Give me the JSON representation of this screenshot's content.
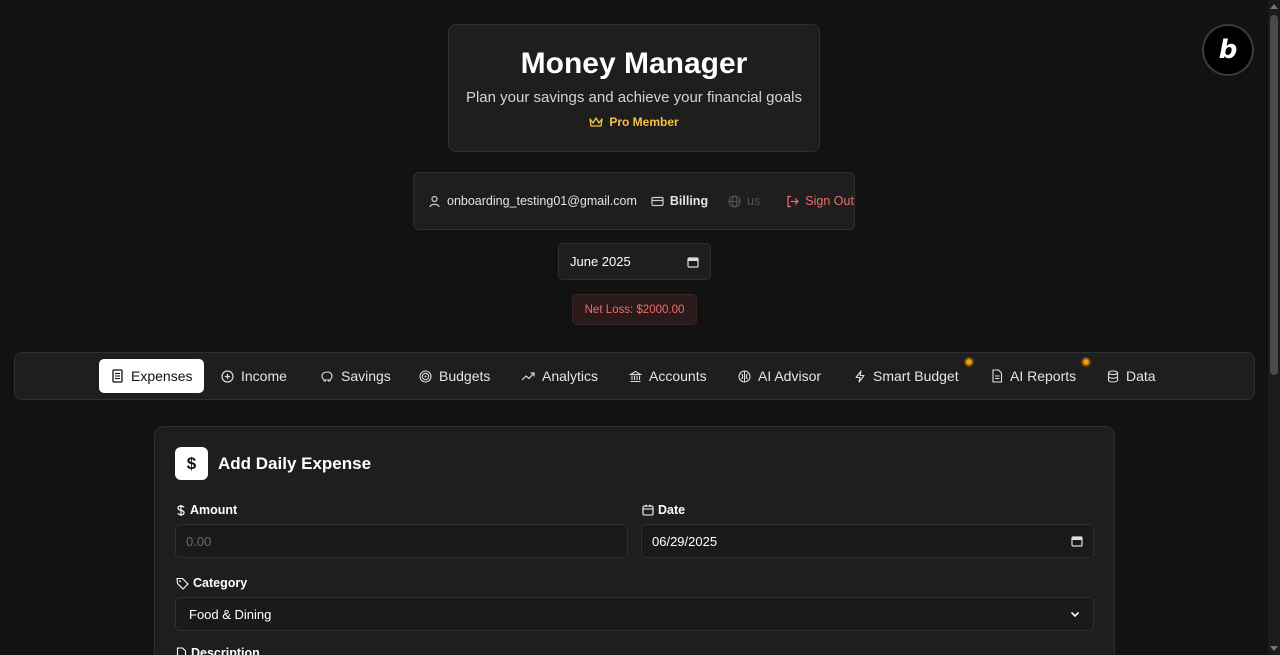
{
  "header": {
    "title": "Money Manager",
    "subtitle": "Plan your savings and achieve your financial goals",
    "badge": "Pro Member"
  },
  "user_bar": {
    "email": "onboarding_testing01@gmail.com",
    "billing": "Billing",
    "language": "us",
    "sign_out": "Sign Out"
  },
  "month_picker": {
    "value": "June 2025"
  },
  "net_loss": "Net Loss: $2000.00",
  "tabs": [
    {
      "label": "Expenses",
      "active": true
    },
    {
      "label": "Income"
    },
    {
      "label": "Savings"
    },
    {
      "label": "Budgets"
    },
    {
      "label": "Analytics"
    },
    {
      "label": "Accounts"
    },
    {
      "label": "AI Advisor"
    },
    {
      "label": "Smart Budget"
    },
    {
      "label": "AI Reports"
    },
    {
      "label": "Data"
    }
  ],
  "expense_form": {
    "heading": "Add Daily Expense",
    "amount_label": "Amount",
    "amount_placeholder": "0.00",
    "date_label": "Date",
    "date_value": "06/29/2025",
    "category_label": "Category",
    "category_value": "Food & Dining",
    "description_label": "Description"
  },
  "colors": {
    "background": "#121212",
    "card": "#1e1e1e",
    "accent_gold": "#f5c242",
    "danger": "#f26b6b",
    "notification_dot": "#f59e0b"
  }
}
